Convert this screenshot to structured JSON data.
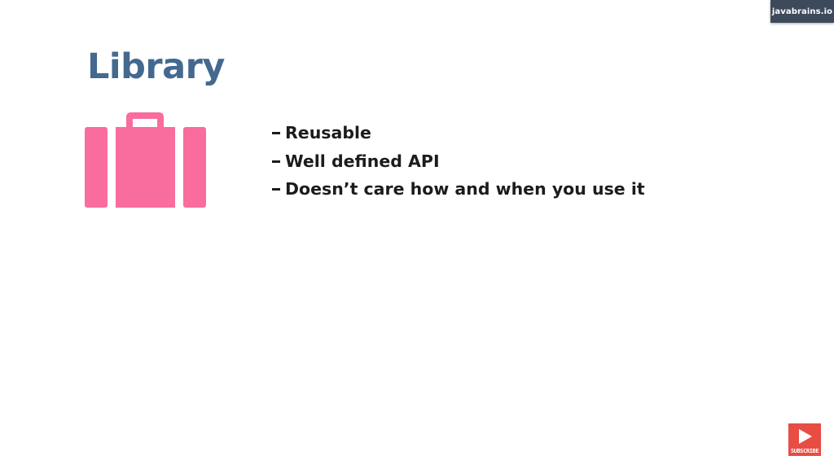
{
  "brand": {
    "label": "javabrains.io"
  },
  "slide": {
    "title": "Library",
    "icon": "briefcase-icon",
    "accent_color": "#f96c9e",
    "title_color": "#44698f",
    "bullets": [
      "Reusable",
      "Well defined API",
      "Doesn’t care how and when you use it"
    ]
  },
  "subscribe": {
    "icon": "play-icon",
    "label": "SUBSCRIBE",
    "color": "#e84c43"
  }
}
